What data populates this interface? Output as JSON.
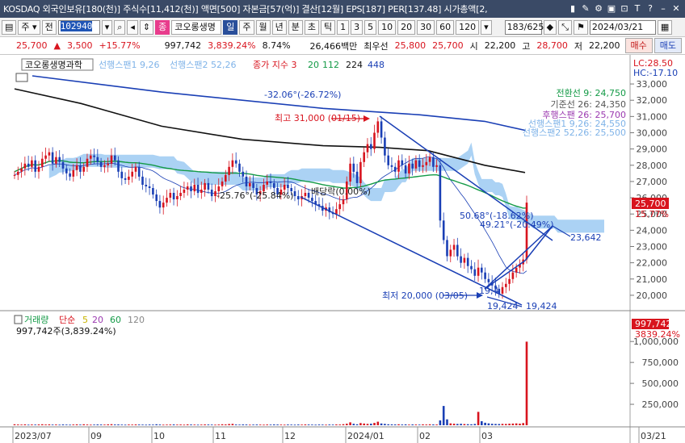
{
  "titlebar": {
    "text": "KOSDAQ 외국인보유[180(천)] 주식수[11,412(천)] 액면[500] 자본금[57(억)] 결산[12월] EPS[187] PER[137.48] 시가총액[2,",
    "icons": [
      "bar-icon",
      "wrench-icon",
      "settings-icon",
      "save-icon",
      "lock-icon",
      "text-icon",
      "help-icon",
      "minimize-icon",
      "close-icon"
    ]
  },
  "toolbar": {
    "box_label": "주",
    "market_label": "전",
    "code": "102940",
    "name_badge": "종",
    "name": "코오롱생명",
    "periods": [
      "일",
      "주",
      "월",
      "년",
      "분",
      "초",
      "틱"
    ],
    "active_period": "일",
    "numbers": [
      "1",
      "3",
      "5",
      "10",
      "20",
      "30",
      "60",
      "120"
    ],
    "count": "183/625",
    "date": "2024/03/21"
  },
  "quote": {
    "price": "25,700",
    "arrow": "▲",
    "change": "3,500",
    "change_pct": "+15.77%",
    "volume": "997,742",
    "volume_pct": "3,839.24%",
    "turnover": "8.74%",
    "amount": "26,466백만",
    "ask_label": "최우선",
    "ask": "25,800",
    "bid": "25,700",
    "open_label": "시",
    "open": "22,200",
    "high_label": "고",
    "high": "28,700",
    "low_label": "저",
    "low": "22,200",
    "buy_label": "매수",
    "sell_label": "매도"
  },
  "chart_data": {
    "type": "candlestick",
    "legend_main": [
      "코오롱생명과학",
      "선행스팬1 9,26",
      "선행스팬2 52,26",
      "종가 지수 3",
      "20",
      "112",
      "224",
      "448"
    ],
    "indicator_values": [
      {
        "label": "전환선 9: 24,750",
        "color": "#139a46"
      },
      {
        "label": "기준선 26: 24,350",
        "color": "#555555"
      },
      {
        "label": "후행스팬 26: 25,700",
        "color": "#9b3ab0"
      },
      {
        "label": "선행스팬1 9,26: 24,550",
        "color": "#7fb3e8"
      },
      {
        "label": "선행스팬2 52,26: 25,500",
        "color": "#7fb3e8"
      }
    ],
    "lc_label": "LC:28.50",
    "hc_label": "HC:-17.10",
    "price_axis": [
      "33,000",
      "32,000",
      "31,000",
      "30,000",
      "29,000",
      "28,000",
      "27,000",
      "26,000",
      "25,000",
      "24,000",
      "23,000",
      "22,000",
      "21,000",
      "20,000"
    ],
    "price_ylim": [
      19400,
      33500
    ],
    "current_price": "25,700",
    "current_change": "15.77%",
    "annotations": {
      "high": "최고 31,000 (01/15)",
      "low": "최저 20,000 (03/05)",
      "angle_top": "-32.06°(-26.72%)",
      "angle_mid": "-25.76°(-25.84%)",
      "arrangement": "배당락(0.00%)",
      "channel_a": "50.68°(-18.62%)",
      "channel_b": "49.21°(-20.49%)",
      "target": "23,642",
      "low_a": "19,424",
      "low_b": "19,424",
      "low_c": "19,4"
    },
    "volume_legend": [
      "거래량",
      "단순",
      "5",
      "20",
      "60",
      "120"
    ],
    "volume_value": "997,742주(3,839.24%)",
    "volume_axis": [
      "1,000,000",
      "750,000",
      "500,000",
      "250,000"
    ],
    "volume_ylim": [
      0,
      1050000
    ],
    "volume_current": "997,742",
    "volume_current_pct": "3839.24%",
    "x_labels": [
      "2023/07",
      "09",
      "10",
      "11",
      "12",
      "2024/01",
      "02",
      "03",
      "03/21"
    ],
    "close": [
      27400,
      27600,
      27800,
      28100,
      27900,
      28300,
      27600,
      27900,
      28400,
      28600,
      28800,
      28100,
      28500,
      28200,
      27800,
      27500,
      27300,
      27700,
      28000,
      27600,
      27900,
      28400,
      28600,
      28500,
      28200,
      27900,
      28000,
      28100,
      28600,
      28300,
      27600,
      27200,
      27100,
      27300,
      27600,
      27900,
      27300,
      26800,
      26700,
      26600,
      26200,
      25800,
      25400,
      25700,
      26000,
      26300,
      25900,
      26100,
      26300,
      26500,
      26700,
      26400,
      26800,
      26300,
      26500,
      26900,
      26500,
      26100,
      26400,
      26700,
      27000,
      27400,
      27900,
      28300,
      28100,
      27600,
      27300,
      26700,
      26900,
      26600,
      26200,
      26400,
      26800,
      27000,
      26900,
      26600,
      26200,
      26500,
      26800,
      26600,
      26400,
      26100,
      25900,
      26100,
      26300,
      26000,
      25800,
      25600,
      25500,
      25200,
      25400,
      25100,
      25000,
      25300,
      25600,
      25900,
      27000,
      28100,
      27600,
      26900,
      28200,
      28800,
      29300,
      29000,
      30000,
      30700,
      29700,
      28600,
      28000,
      27900,
      27600,
      28300,
      28000,
      27500,
      28100,
      27800,
      28300,
      27900,
      28000,
      28200,
      28500,
      27900,
      28000,
      24600,
      23400,
      22400,
      22800,
      23100,
      22400,
      22000,
      22300,
      21800,
      21600,
      21200,
      21700,
      21400,
      21000,
      20800,
      20600,
      20400,
      20100,
      20500,
      20700,
      21000,
      21400,
      21700,
      21900,
      22200,
      25700
    ],
    "volume": [
      12000,
      9000,
      8000,
      11000,
      7000,
      9000,
      8000,
      10000,
      12000,
      9000,
      11000,
      8000,
      9000,
      7000,
      10000,
      8000,
      7000,
      9000,
      11000,
      8000,
      12000,
      9000,
      7000,
      8000,
      10000,
      9000,
      8000,
      11000,
      13000,
      9000,
      10000,
      8000,
      7000,
      9000,
      8000,
      10000,
      9000,
      8000,
      7000,
      9000,
      8000,
      12000,
      9000,
      7000,
      8000,
      9000,
      10000,
      8000,
      9000,
      7000,
      11000,
      9000,
      8000,
      7000,
      8000,
      10000,
      9000,
      8000,
      7000,
      9000,
      12000,
      10000,
      14000,
      16000,
      9000,
      8000,
      10000,
      9000,
      7000,
      8000,
      9000,
      8000,
      7000,
      9000,
      8000,
      10000,
      9000,
      8000,
      7000,
      9000,
      8000,
      7000,
      9000,
      8000,
      10000,
      9000,
      8000,
      7000,
      9000,
      8000,
      7000,
      9000,
      8000,
      10000,
      9000,
      13000,
      18000,
      35000,
      17000,
      12000,
      26000,
      20000,
      16000,
      18000,
      28000,
      42000,
      21000,
      16000,
      12000,
      11000,
      10000,
      12000,
      9000,
      11000,
      8000,
      10000,
      9000,
      8000,
      11000,
      9000,
      12000,
      10000,
      9000,
      58000,
      230000,
      70000,
      22000,
      18000,
      15000,
      17000,
      14000,
      13000,
      12000,
      15000,
      160000,
      48000,
      30000,
      22000,
      17000,
      15000,
      14000,
      16000,
      15000,
      18000,
      20000,
      22000,
      19000,
      26000,
      997742
    ]
  }
}
